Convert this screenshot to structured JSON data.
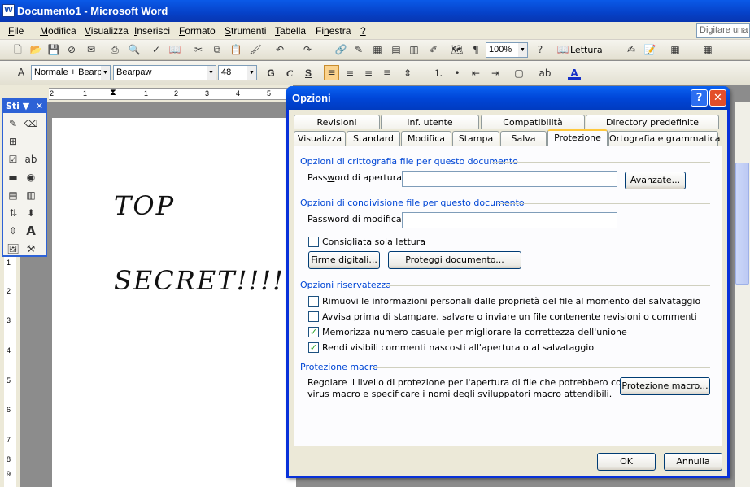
{
  "app": {
    "title": "Documento1 - Microsoft Word",
    "icon": "word-doc-icon"
  },
  "menu": {
    "items": [
      {
        "pre": "",
        "u": "F",
        "post": "ile"
      },
      {
        "pre": "",
        "u": "M",
        "post": "odifica"
      },
      {
        "pre": "",
        "u": "V",
        "post": "isualizza"
      },
      {
        "pre": "",
        "u": "I",
        "post": "nserisci"
      },
      {
        "pre": "",
        "u": "F",
        "post": "ormato"
      },
      {
        "pre": "",
        "u": "S",
        "post": "trumenti"
      },
      {
        "pre": "",
        "u": "T",
        "post": "abella"
      },
      {
        "pre": "Fi",
        "u": "n",
        "post": "estra"
      },
      {
        "pre": "",
        "u": "?",
        "post": ""
      }
    ],
    "ask_placeholder": "Digitare una d"
  },
  "toolbar": {
    "zoom": "100%",
    "reading_label": "Lettura"
  },
  "format_bar": {
    "style": "Normale + Bearp",
    "font": "Bearpaw",
    "size": "48",
    "bold": "G",
    "italic": "C",
    "underline": "S"
  },
  "ruler": {
    "h_numbers": [
      "2",
      "1",
      "1",
      "2",
      "3",
      "4",
      "5"
    ],
    "v_numbers": [
      "1",
      "2",
      "3",
      "4",
      "5",
      "6",
      "7",
      "8",
      "9"
    ]
  },
  "forms_toolbar": {
    "title": "Sti"
  },
  "document": {
    "line1": "TOP",
    "line2": "SECRET!!!!"
  },
  "dialog": {
    "title": "Opzioni",
    "tabs_row1": [
      "Revisioni",
      "Inf. utente",
      "Compatibilità",
      "Directory predefinite"
    ],
    "tabs_row2": [
      "Visualizza",
      "Standard",
      "Modifica",
      "Stampa",
      "Salva",
      "Protezione",
      "Ortografia e grammatica"
    ],
    "selected_tab": "Protezione",
    "encryption": {
      "section": "Opzioni di crittografia file per questo documento",
      "password_open_pre": "Pass",
      "password_open_u": "w",
      "password_open_post": "ord di apertura:",
      "password_open_value": "",
      "advanced_button": "Avanzate..."
    },
    "sharing": {
      "section": "Opzioni di condivisione file per questo documento",
      "password_modify_label": "Password di modifica:",
      "password_modify_value": "",
      "read_only_label": "Consigliata sola lettura",
      "read_only_checked": false,
      "digital_signatures_button": "Firme digitali...",
      "protect_document_button": "Proteggi documento..."
    },
    "privacy": {
      "section": "Opzioni riservatezza",
      "options": [
        {
          "label": "Rimuovi le informazioni personali dalle proprietà del file al momento del salvataggio",
          "checked": false
        },
        {
          "label": "Avvisa prima di stampare, salvare o inviare un file contenente revisioni o commenti",
          "checked": false
        },
        {
          "label": "Memorizza numero casuale per migliorare la correttezza dell'unione",
          "checked": true
        },
        {
          "label": "Rendi visibili commenti nascosti all'apertura o al salvataggio",
          "checked": true
        }
      ]
    },
    "macro": {
      "section": "Protezione macro",
      "description_line1": "Regolare il livello di protezione per l'apertura di file che potrebbero contenere",
      "description_line2": "virus macro e specificare i nomi degli sviluppatori macro attendibili.",
      "macro_button": "Protezione macro..."
    },
    "ok_button": "OK",
    "cancel_button": "Annulla",
    "help_icon": "?",
    "close_icon": "✕"
  }
}
